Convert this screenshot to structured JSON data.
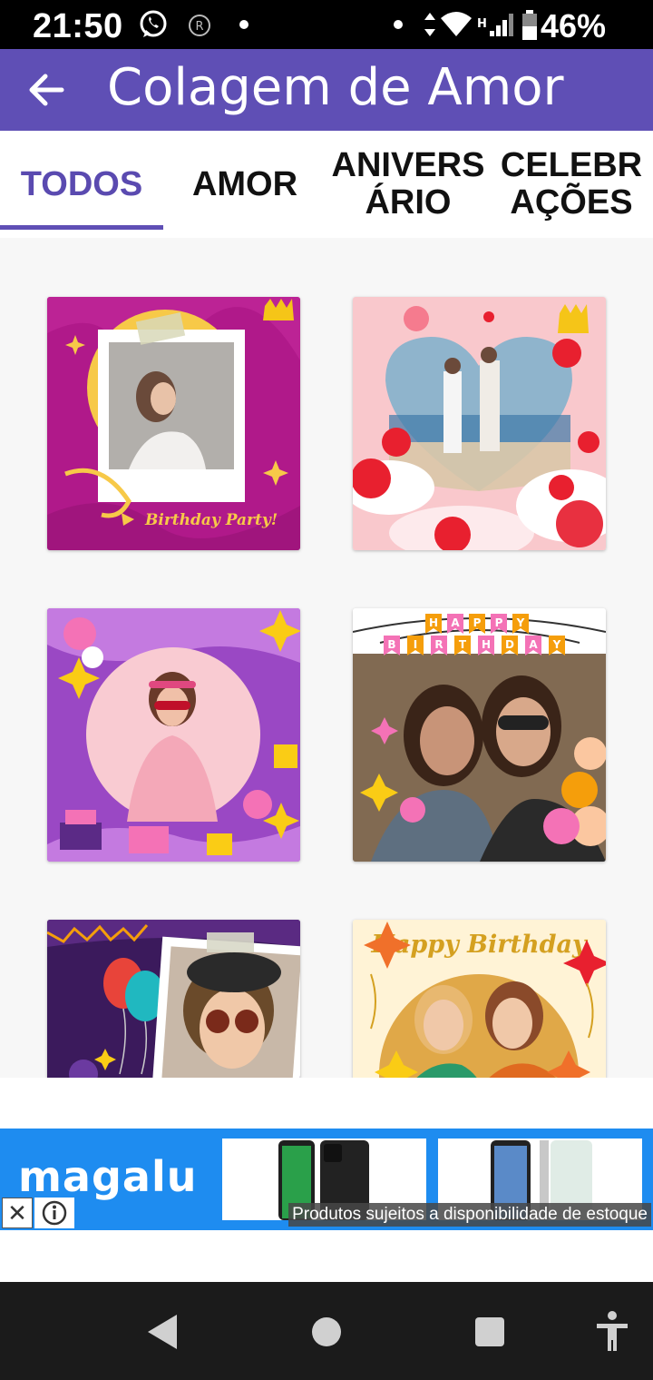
{
  "status_bar": {
    "time": "21:50",
    "battery": "46%",
    "icons": [
      "whatsapp-icon",
      "nfc-icon",
      "dot-icon",
      "data-arrows-icon",
      "wifi-icon",
      "signal-icon",
      "battery-icon"
    ]
  },
  "app_bar": {
    "title": "Colagem de Amor",
    "back_icon": "arrow-left-icon",
    "color": "#5f4fb5"
  },
  "tabs": [
    {
      "label": "TODOS",
      "active": true
    },
    {
      "label": "AMOR",
      "active": false
    },
    {
      "label": "ANIVERS\nÁRIO",
      "active": false
    },
    {
      "label": "CELEBR\nAÇÕES",
      "active": false
    }
  ],
  "templates": [
    {
      "name": "birthday-party-polaroid",
      "caption": "Birthday Party!",
      "premium": true
    },
    {
      "name": "heart-love-frame",
      "premium": true
    },
    {
      "name": "purple-circle-birthday",
      "premium": false
    },
    {
      "name": "happy-birthday-banner",
      "banner_top": "HAPPY",
      "banner_bottom": "BIRTHDAY",
      "premium": false
    },
    {
      "name": "balloons-photo-frame",
      "premium": false
    },
    {
      "name": "happy-birthday-stars",
      "caption": "Happy Birthday",
      "premium": false
    }
  ],
  "ad": {
    "brand": "magalu",
    "disclaimer": "Produtos sujeitos a disponibilidade de estoque",
    "close_icon": "close-icon",
    "info_icon": "info-icon",
    "color": "#1e8cf0"
  },
  "nav_bar": {
    "buttons": [
      "back-triangle-icon",
      "home-circle-icon",
      "recents-square-icon",
      "accessibility-icon"
    ]
  }
}
